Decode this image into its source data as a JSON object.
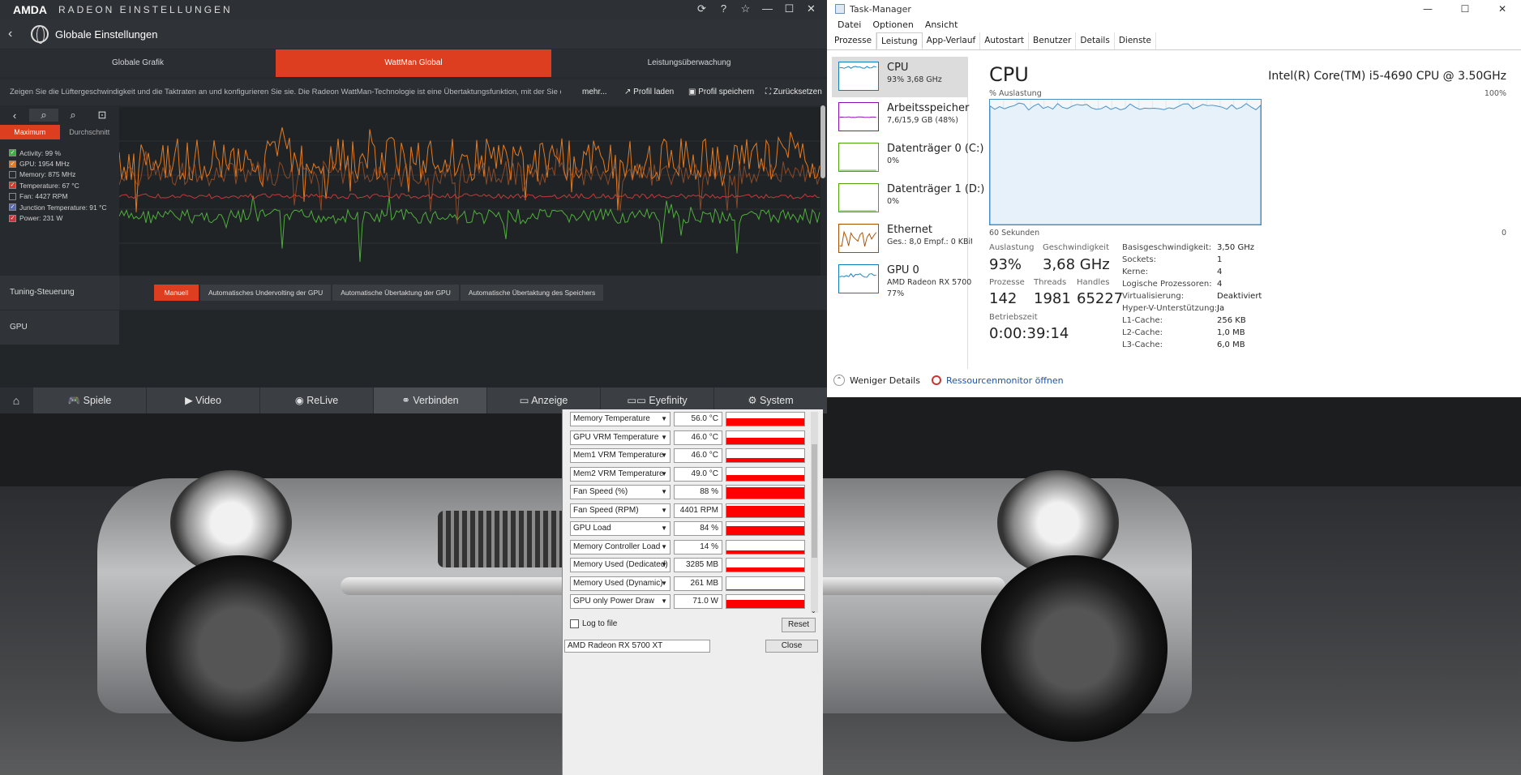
{
  "amd": {
    "logo": "AMDA",
    "app_title": "RADEON EINSTELLUNGEN",
    "nav_title": "Globale Einstellungen",
    "tabs": [
      "Globale Grafik",
      "WattMan Global",
      "Leistungsüberwachung"
    ],
    "description": "Zeigen Sie die Lüftergeschwindigkeit und die Taktraten an und konfigurieren Sie sie. Die Radeon WattMan-Technologie ist eine Übertaktungsfunktion, mit der Sie di...",
    "more": "mehr...",
    "load_profile": "Profil laden",
    "save_profile": "Profil speichern",
    "reset": "Zurücksetzen",
    "modes": [
      "Maximum",
      "Durchschnitt"
    ],
    "legend": [
      {
        "label": "Activity: 99 %",
        "color": "#3fae45",
        "checked": true
      },
      {
        "label": "GPU: 1954 MHz",
        "color": "#e57a1e",
        "checked": true
      },
      {
        "label": "Memory: 875 MHz",
        "color": "#888888",
        "checked": false
      },
      {
        "label": "Temperature: 67 °C",
        "color": "#d33a2c",
        "checked": true
      },
      {
        "label": "Fan: 4427 RPM",
        "color": "#888888",
        "checked": false
      },
      {
        "label": "Junction Temperature: 91 °C",
        "color": "#5a6aa8",
        "checked": true
      },
      {
        "label": "Power: 231 W",
        "color": "#c23b3b",
        "checked": true
      }
    ],
    "tuning_label": "Tuning-Steuerung",
    "tuning_options": [
      "Manuell",
      "Automatisches Undervolting der GPU",
      "Automatische Übertaktung der GPU",
      "Automatische Übertaktung des Speichers"
    ],
    "gpu_label": "GPU",
    "bottom_nav": [
      "Spiele",
      "Video",
      "ReLive",
      "Verbinden",
      "Anzeige",
      "Eyefinity",
      "System"
    ]
  },
  "hwinfo": {
    "rows": [
      {
        "name": "Memory Temperature",
        "value": "56.0 °C",
        "level": 0.55
      },
      {
        "name": "GPU VRM Temperature",
        "value": "46.0 °C",
        "level": 0.45
      },
      {
        "name": "Mem1 VRM Temperature",
        "value": "46.0 °C",
        "level": 0.3
      },
      {
        "name": "Mem2 VRM Temperature",
        "value": "49.0 °C",
        "level": 0.4
      },
      {
        "name": "Fan Speed (%)",
        "value": "88 %",
        "level": 0.85
      },
      {
        "name": "Fan Speed (RPM)",
        "value": "4401 RPM",
        "level": 0.85
      },
      {
        "name": "GPU Load",
        "value": "84 %",
        "level": 0.7
      },
      {
        "name": "Memory Controller Load",
        "value": "14 %",
        "level": 0.2
      },
      {
        "name": "Memory Used (Dedicated)",
        "value": "3285 MB",
        "level": 0.3
      },
      {
        "name": "Memory Used (Dynamic)",
        "value": "261 MB",
        "level": 0.05
      },
      {
        "name": "GPU only Power Draw",
        "value": "71.0 W",
        "level": 0.6
      }
    ],
    "log_to_file": "Log to file",
    "reset": "Reset",
    "gpu_select": "AMD Radeon RX 5700 XT",
    "close": "Close"
  },
  "tm": {
    "title": "Task-Manager",
    "menu": [
      "Datei",
      "Optionen",
      "Ansicht"
    ],
    "tabs": [
      "Prozesse",
      "Leistung",
      "App-Verlauf",
      "Autostart",
      "Benutzer",
      "Details",
      "Dienste"
    ],
    "side": [
      {
        "name": "CPU",
        "sub": "93% 3,68 GHz",
        "color": "#117dbb"
      },
      {
        "name": "Arbeitsspeicher",
        "sub": "7,6/15,9 GB (48%)",
        "color": "#8b12ae"
      },
      {
        "name": "Datenträger 0 (C:)",
        "sub": "0%",
        "color": "#4da60c"
      },
      {
        "name": "Datenträger 1 (D:)",
        "sub": "0%",
        "color": "#4da60c"
      },
      {
        "name": "Ethernet",
        "sub": "Ges.: 8,0 Empf.: 0 KBit/s",
        "color": "#a74f01"
      },
      {
        "name": "GPU 0",
        "sub": "AMD Radeon RX 5700 XT",
        "sub2": "77%",
        "color": "#117dbb"
      }
    ],
    "cpu_title": "CPU",
    "cpu_name": "Intel(R) Core(TM) i5-4690 CPU @ 3.50GHz",
    "graph_label": "% Auslastung",
    "graph_max": "100%",
    "graph_time": "60 Sekunden",
    "graph_min": "0",
    "stats": {
      "auslastung_l": "Auslastung",
      "auslastung_v": "93%",
      "geschw_l": "Geschwindigkeit",
      "geschw_v": "3,68 GHz",
      "prozesse_l": "Prozesse",
      "prozesse_v": "142",
      "threads_l": "Threads",
      "threads_v": "1981",
      "handles_l": "Handles",
      "handles_v": "65227",
      "betrieb_l": "Betriebszeit",
      "betrieb_v": "0:00:39:14"
    },
    "info": [
      [
        "Basisgeschwindigkeit:",
        "3,50 GHz"
      ],
      [
        "Sockets:",
        "1"
      ],
      [
        "Kerne:",
        "4"
      ],
      [
        "Logische Prozessoren:",
        "4"
      ],
      [
        "Virtualisierung:",
        "Deaktiviert"
      ],
      [
        "Hyper-V-Unterstützung:",
        "Ja"
      ],
      [
        "L1-Cache:",
        "256 KB"
      ],
      [
        "L2-Cache:",
        "1,0 MB"
      ],
      [
        "L3-Cache:",
        "6,0 MB"
      ]
    ],
    "fewer": "Weniger Details",
    "resmon": "Ressourcenmonitor öffnen"
  }
}
